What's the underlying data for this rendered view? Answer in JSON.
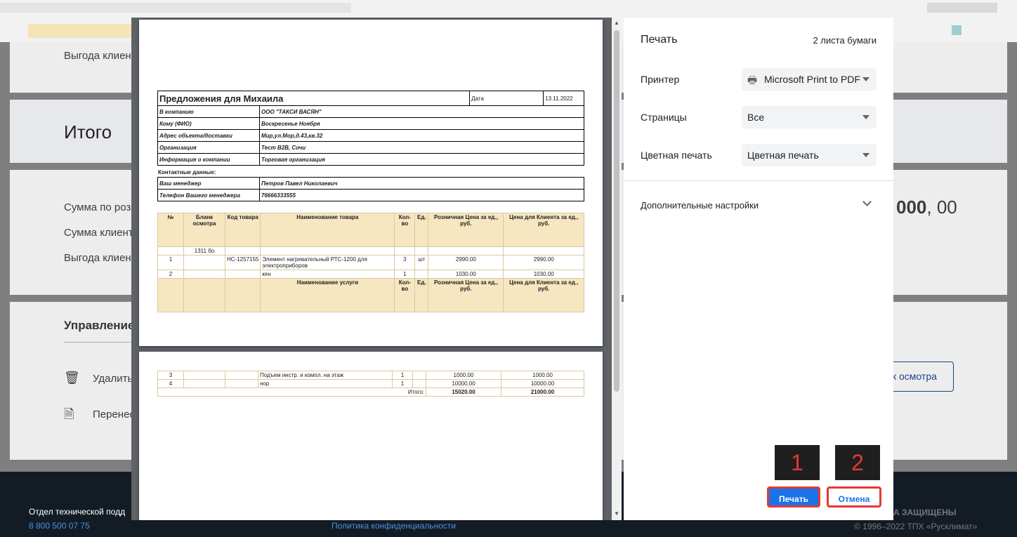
{
  "background": {
    "rows": [
      "Выгода клиент",
      "Итого",
      "Сумма по розн",
      "Сумма клиент",
      "Выгода клиент",
      "Управление",
      "Удалить",
      "Перенес"
    ],
    "total_amount_main": "000",
    "total_amount_cents": ", 00",
    "inspection_button": "к осмотра",
    "footer": {
      "support": "Отдел технической подд",
      "phone": "8 800 500 07 75",
      "privacy": "Политика конфиденциальности",
      "rights": "А ЗАЩИЩЕНЫ",
      "copyright": "© 1996–2022 ТПХ «Русклимат»"
    }
  },
  "document": {
    "title": "Предложения для Михаила",
    "date_label": "Дата",
    "date_value": "13.11.2022",
    "info": [
      {
        "label": "В компанию",
        "value": "ООО \"ТАКСИ ВАСЯН\""
      },
      {
        "label": "Кому (ФИО)",
        "value": "Воскресенье Ноября"
      },
      {
        "label": "Адрес объекта/доставки",
        "value": "Мир,ул.Мор,д.43,кв.32"
      },
      {
        "label": "Организация",
        "value": "Тест B2B, Сочи"
      },
      {
        "label": "Информация о компании",
        "value": "Торговая организация"
      }
    ],
    "contacts_heading": "Контактные данные:",
    "contacts": [
      {
        "label": "Ваш менеджер",
        "value": "Петров Павел Николаевич"
      },
      {
        "label": "Телефон Вашего менеджера",
        "value": "76666333555"
      }
    ],
    "product_headers": [
      "№",
      "Бланк осмотра",
      "Код товара",
      "Наименование товара",
      "Кол-во",
      "Ед.",
      "Розничная Цена за ед., руб.",
      "Цена для Клиента за ед., руб."
    ],
    "blank_number": "1311 бо",
    "products": [
      {
        "n": "1",
        "code": "НС-1257155",
        "name": "Элемент нагревательный РТС-1200 для электроприборов",
        "qty": "3",
        "unit": "шт",
        "retail": "2990.00",
        "client": "2990.00"
      },
      {
        "n": "2",
        "code": "",
        "name": "кен",
        "qty": "1",
        "unit": "",
        "retail": "1030.00",
        "client": "1030.00"
      }
    ],
    "service_headers": [
      "Наименование услуги",
      "Кол-во",
      "Ед.",
      "Розничная Цена за ед., руб.",
      "Цена для Клиента за ед., руб."
    ],
    "services": [
      {
        "n": "3",
        "name": "Подъем инстр. и компл. на этаж",
        "qty": "1",
        "retail": "1000.00",
        "client": "1000.00"
      },
      {
        "n": "4",
        "name": "нор",
        "qty": "1",
        "retail": "10000.00",
        "client": "10000.00"
      }
    ],
    "total_label": "Итого:",
    "total_retail": "15020.00",
    "total_client": "21000.00"
  },
  "print_panel": {
    "title": "Печать",
    "sheets": "2 листа бумаги",
    "printer_label": "Принтер",
    "printer_value": "Microsoft Print to PDF",
    "pages_label": "Страницы",
    "pages_value": "Все",
    "color_label": "Цветная печать",
    "color_value": "Цветная печать",
    "more_settings": "Дополнительные настройки",
    "print_button": "Печать",
    "cancel_button": "Отмена",
    "primary_color": "#1a73e8",
    "highlight_color": "#e53935"
  },
  "annotations": [
    "1",
    "2"
  ]
}
